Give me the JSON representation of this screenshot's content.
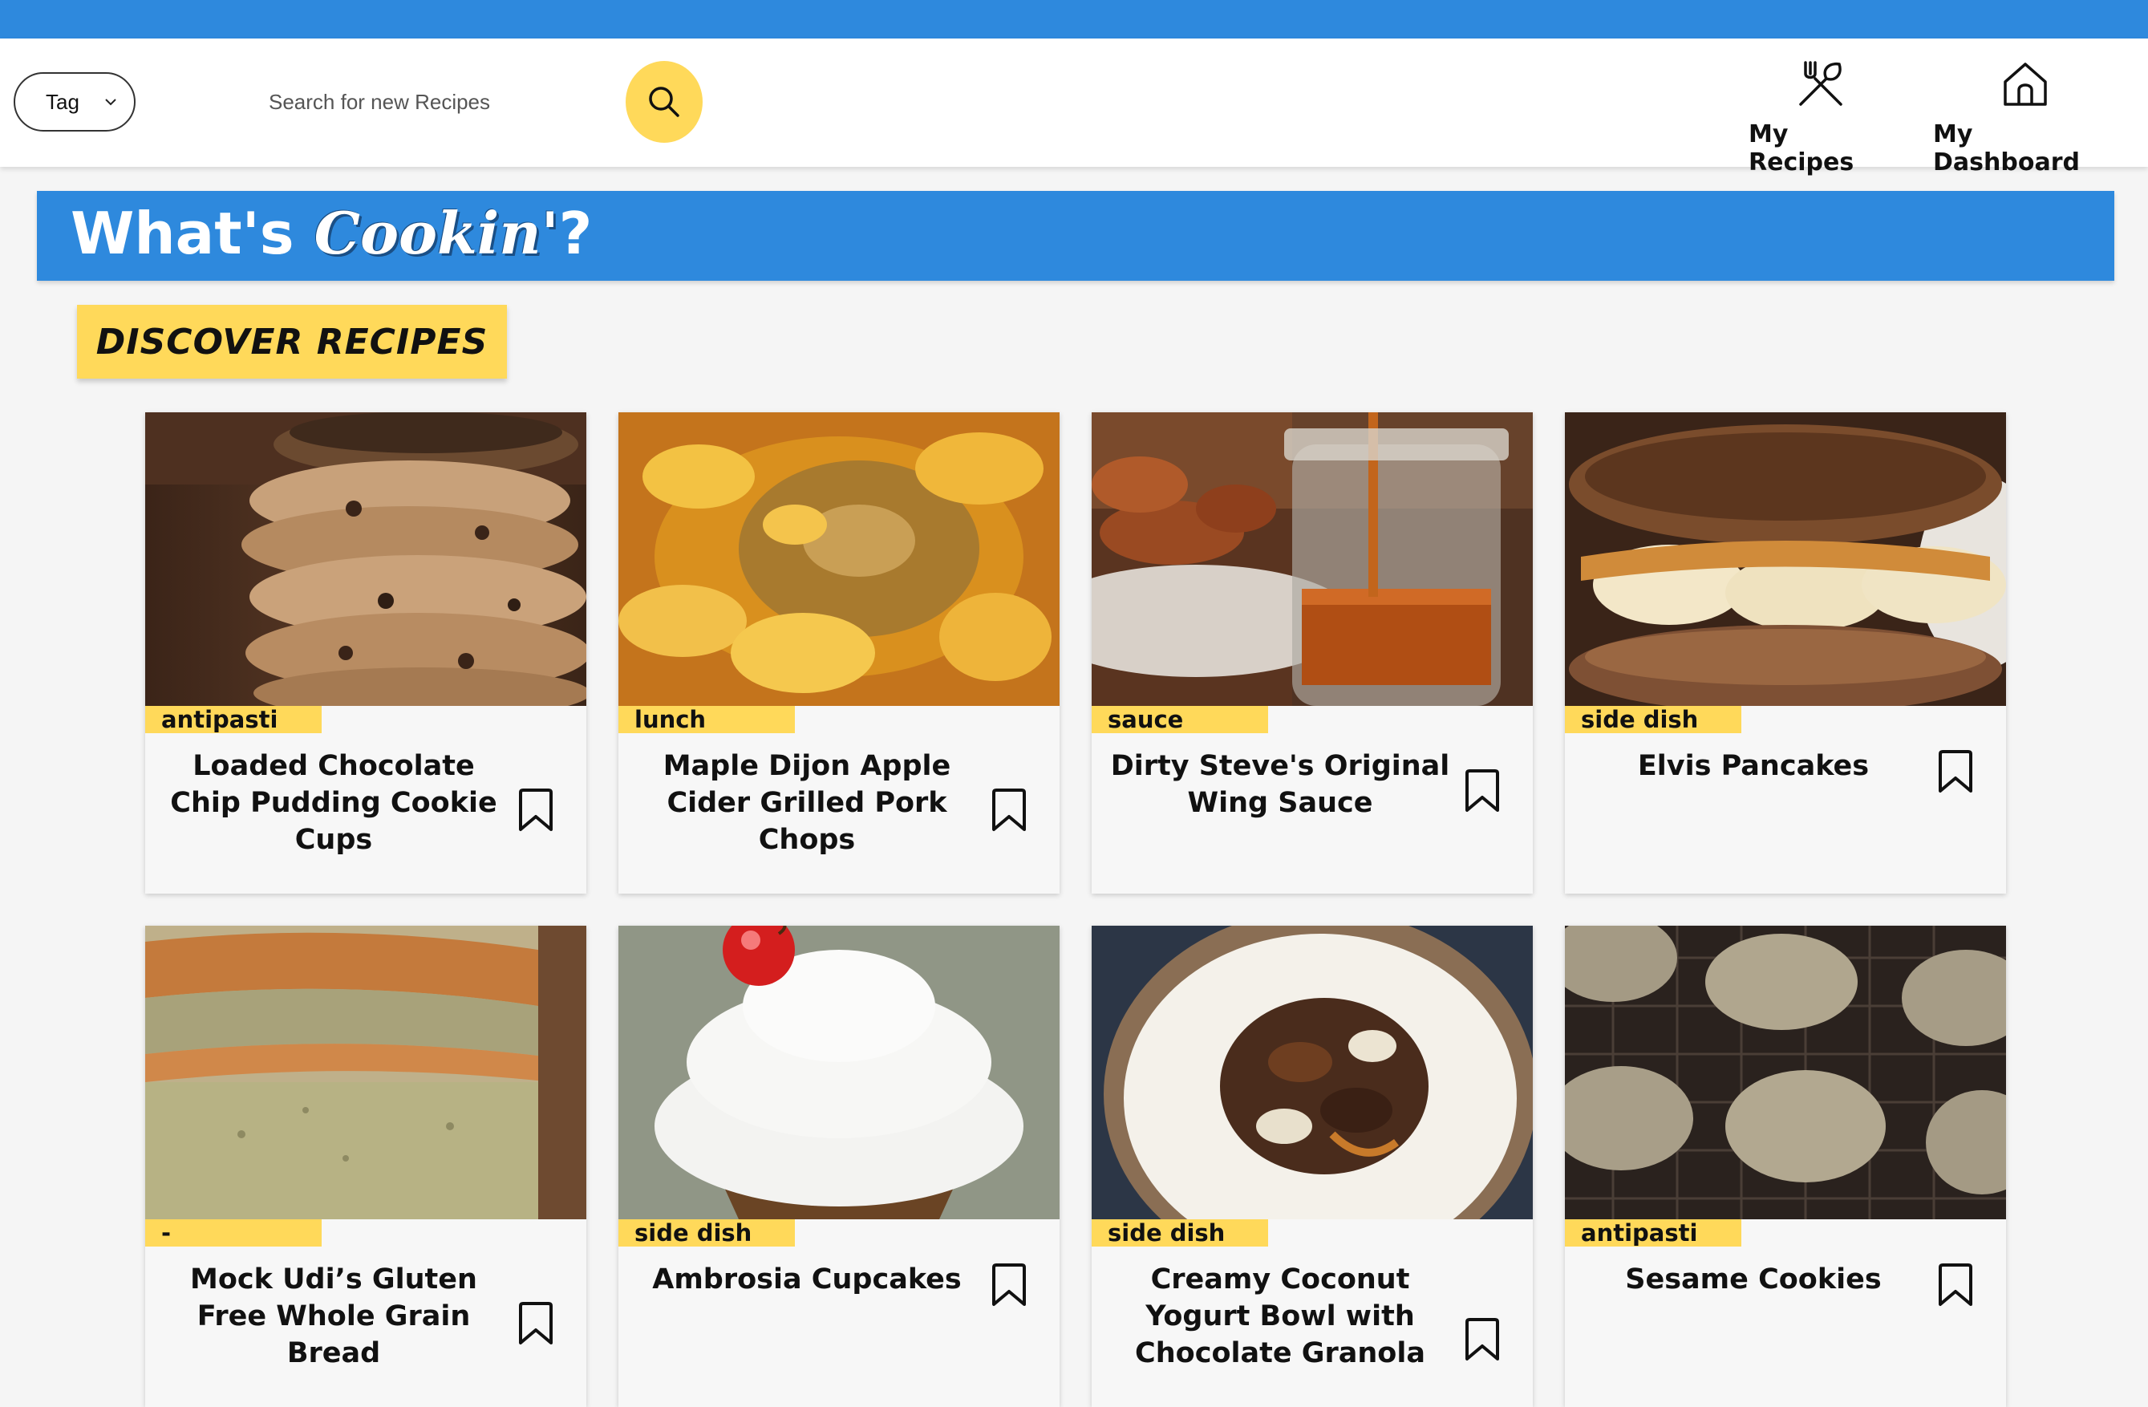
{
  "header": {
    "tag_select_value": "Tag",
    "search_placeholder": "Search for new Recipes",
    "nav": [
      {
        "label": "My Recipes",
        "icon": "fork-knife-icon"
      },
      {
        "label": "My Dashboard",
        "icon": "home-icon"
      }
    ]
  },
  "banner": {
    "prefix": "What's ",
    "script_word": "Cookin'",
    "suffix": "?"
  },
  "section": {
    "heading": "DISCOVER RECIPES"
  },
  "colors": {
    "brand_blue": "#2e89dd",
    "accent_yellow": "#ffd95a"
  },
  "recipes": [
    {
      "tag": "antipasti",
      "title": "Loaded Chocolate Chip Pudding Cookie Cups",
      "image": "cookie-stack-photo"
    },
    {
      "tag": "lunch",
      "title": "Maple Dijon Apple Cider Grilled Pork Chops",
      "image": "pork-chops-photo"
    },
    {
      "tag": "sauce",
      "title": "Dirty Steve's Original Wing Sauce",
      "image": "wing-sauce-jar-photo"
    },
    {
      "tag": "side dish",
      "title": "Elvis Pancakes",
      "image": "banana-pancakes-photo"
    },
    {
      "tag": "-",
      "title": "Mock Udi’s Gluten Free Whole Grain Bread",
      "image": "bread-loaf-photo"
    },
    {
      "tag": "side dish",
      "title": "Ambrosia Cupcakes",
      "image": "cupcake-photo"
    },
    {
      "tag": "side dish",
      "title": "Creamy Coconut Yogurt Bowl with Chocolate Granola",
      "image": "yogurt-bowl-photo"
    },
    {
      "tag": "antipasti",
      "title": "Sesame Cookies",
      "image": "sesame-cookies-photo"
    }
  ]
}
